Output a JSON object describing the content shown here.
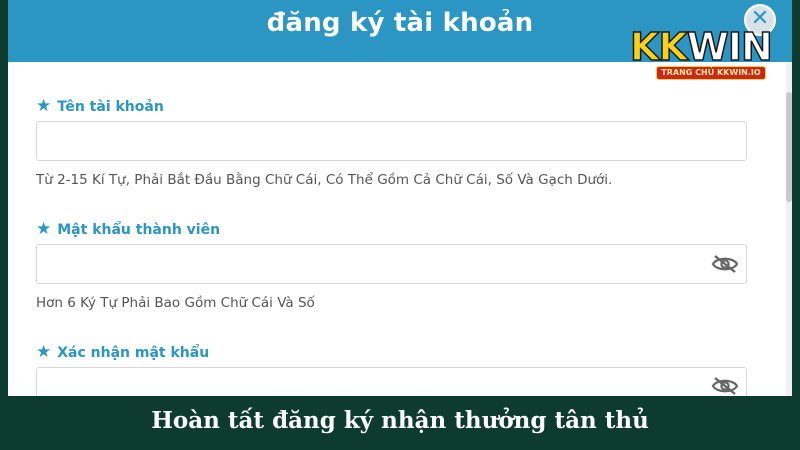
{
  "modal": {
    "title": "đăng ký tài khoản",
    "close_label": "✕"
  },
  "logo": {
    "brand_kk": "KK",
    "brand_win": "WIN",
    "tagline": "TRANG CHỦ KKWIN.IO"
  },
  "form": {
    "username": {
      "label": "Tên tài khoản",
      "value": "",
      "hint": "Từ 2-15 Kí Tự, Phải Bắt Đầu Bằng Chữ Cái, Có Thể Gồm Cả Chữ Cái, Số Và Gạch Dưới."
    },
    "password": {
      "label": "Mật khẩu thành viên",
      "value": "",
      "hint": "Hơn 6 Ký Tự Phải Bao Gồm Chữ Cái Và Số"
    },
    "confirm_password": {
      "label": "Xác nhận mật khẩu",
      "value": ""
    }
  },
  "caption": "Hoàn tất đăng ký nhận thưởng tân thủ",
  "colors": {
    "header": "#2b95c4",
    "label": "#2b95c4",
    "caption_bg": "#0d3b2e"
  }
}
